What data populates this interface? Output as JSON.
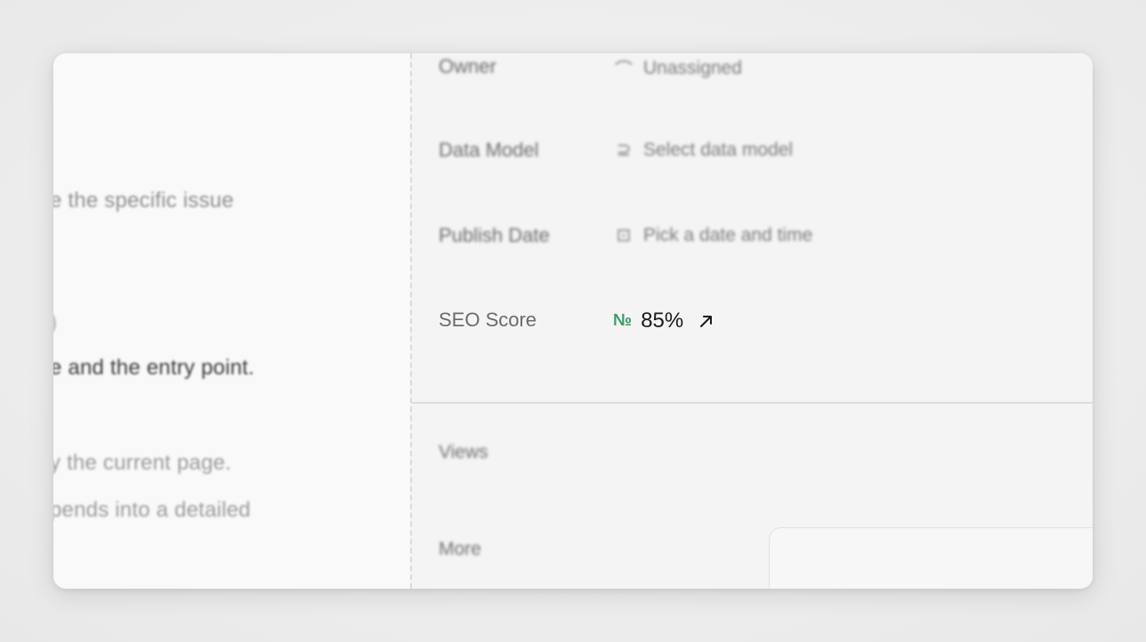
{
  "left_panel": {
    "lines": [
      "e the specific issue",
      ")",
      "e and the entry point.",
      "y the current page.",
      "pends into a detailed"
    ]
  },
  "properties": {
    "owner": {
      "label": "Owner",
      "icon": "user-icon",
      "value": "Unassigned"
    },
    "data_model": {
      "label": "Data Model",
      "icon": "database-icon",
      "value": "Select data model"
    },
    "publish_date": {
      "label": "Publish Date",
      "icon": "calendar-icon",
      "value": "Pick a date and time"
    },
    "seo_score": {
      "label": "SEO Score",
      "icon": "numero-icon",
      "icon_glyph": "№",
      "value": "85%",
      "trend_icon": "arrow-up-right-icon"
    }
  },
  "lower_section": {
    "views_label": "Views",
    "more_label": "More"
  },
  "colors": {
    "seo_icon": "#3f9a6a",
    "label": "#6b6b6b",
    "value": "#1a1a1a"
  }
}
